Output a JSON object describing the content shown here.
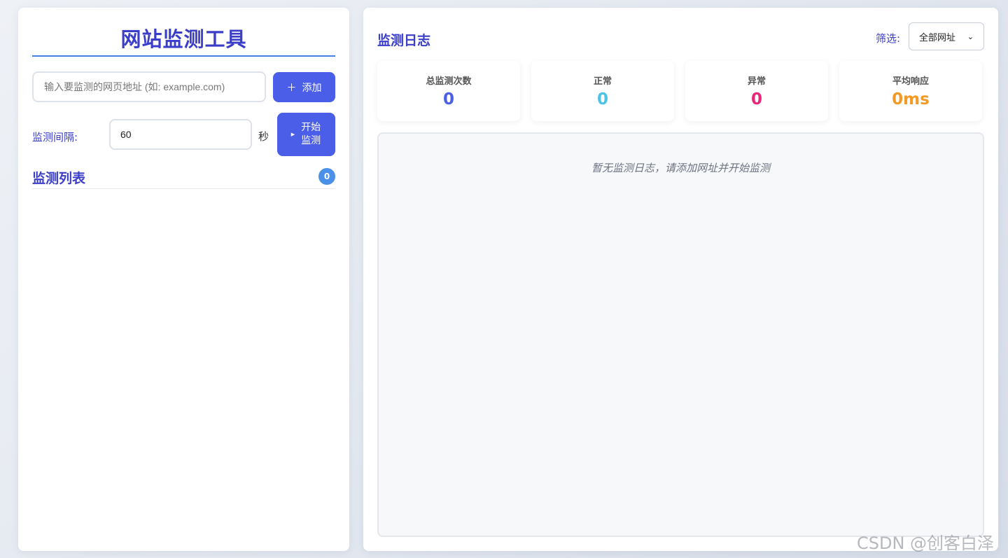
{
  "app": {
    "title": "网站监测工具"
  },
  "add_form": {
    "url_placeholder": "输入要监测的网页地址 (如: example.com)",
    "add_icon": "plus-icon",
    "add_label": "添加"
  },
  "interval": {
    "label": "监测间隔:",
    "value": "60",
    "unit": "秒",
    "start_icon": "play-icon",
    "start_label": "开始监测"
  },
  "monitor_list": {
    "title": "监测列表",
    "count": "0"
  },
  "log": {
    "title": "监测日志",
    "filter_label": "筛选:",
    "filter_value": "全部网址",
    "empty_message": "暂无监测日志，请添加网址并开始监测"
  },
  "stats": [
    {
      "label": "总监测次数",
      "value": "0",
      "color": "#4a5ee8"
    },
    {
      "label": "正常",
      "value": "0",
      "color": "#4cc3e6"
    },
    {
      "label": "异常",
      "value": "0",
      "color": "#e9257a"
    },
    {
      "label": "平均响应",
      "value": "0ms",
      "color": "#f39a26"
    }
  ],
  "watermark": "CSDN @创客白泽"
}
